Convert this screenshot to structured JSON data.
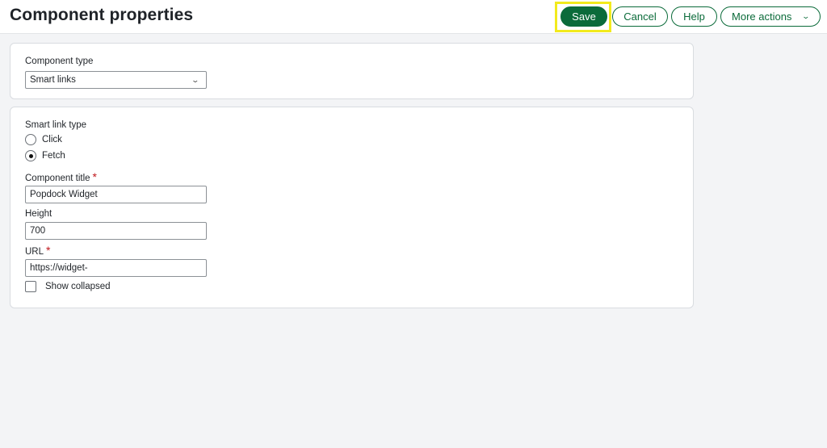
{
  "header": {
    "title": "Component properties",
    "actions": {
      "save": "Save",
      "cancel": "Cancel",
      "help": "Help",
      "more_actions": "More actions"
    }
  },
  "component_card": {
    "type_label": "Component type",
    "type_value": "Smart links"
  },
  "details_card": {
    "smart_link_type_label": "Smart link type",
    "options": [
      {
        "label": "Click",
        "checked": false
      },
      {
        "label": "Fetch",
        "checked": true
      }
    ],
    "title_label": "Component title",
    "title_value": "Popdock Widget",
    "height_label": "Height",
    "height_value": "700",
    "url_label": "URL",
    "url_value": "https://widget-",
    "show_collapsed_label": "Show collapsed",
    "show_collapsed_checked": false,
    "required_mark": "*"
  },
  "colors": {
    "accent": "#0b6b3a",
    "highlight": "#f2ea1d",
    "required": "#c0171c"
  },
  "icons": {
    "more_actions_chevron": "chevron-down-icon",
    "select_chevron": "chevron-down-icon"
  }
}
